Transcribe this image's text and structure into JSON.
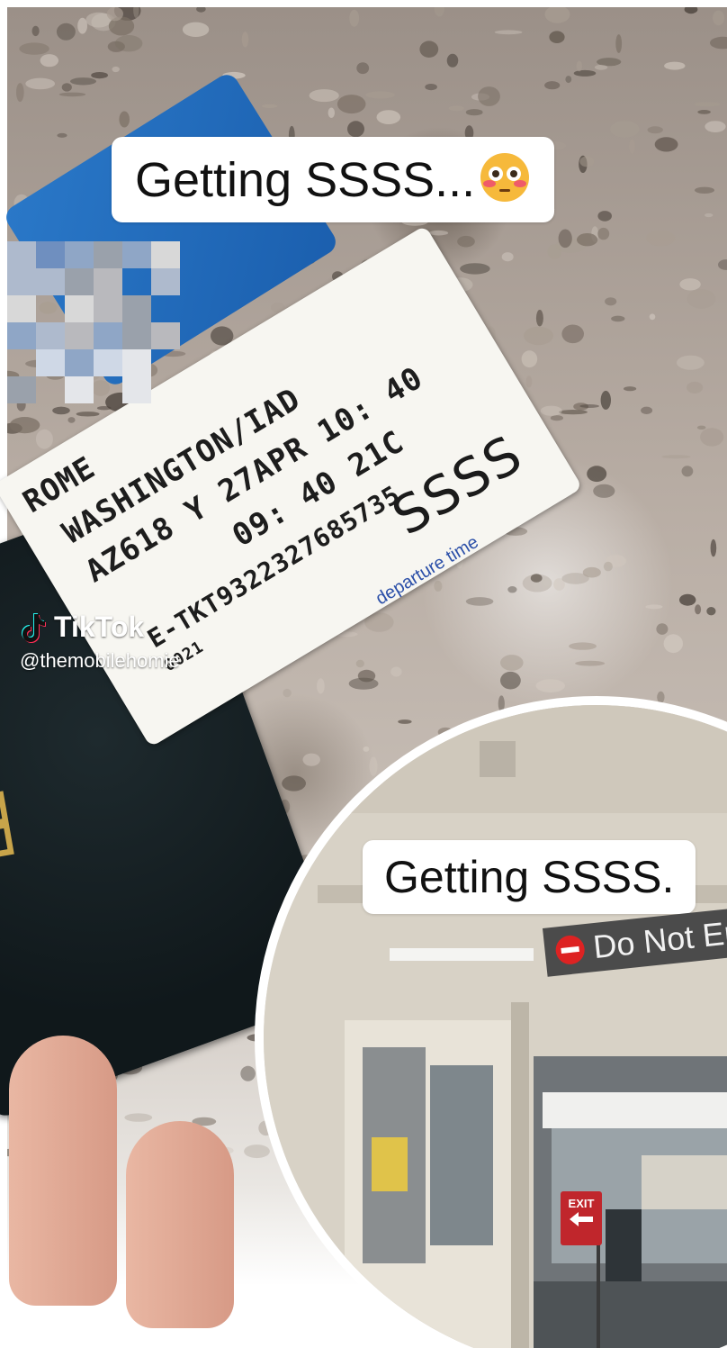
{
  "captions": {
    "top": "Getting SSSS...",
    "inset": "Getting SSSS."
  },
  "boarding_pass": {
    "line1": "ROME",
    "line2": "WASHINGTON/IAD",
    "line3": "AZ618   Y 27APR  10: 40",
    "line4": "09: 40  21C",
    "line5": "E-TKT9322327685735",
    "line6": "0021",
    "ssss": "SSSS",
    "note": "departure time"
  },
  "watermark": {
    "brand": "TikTok",
    "handle": "@themobilehomie"
  },
  "passport": {
    "visible_text": "RT"
  },
  "signs": {
    "do_not_enter": "Do Not Ent",
    "exit": "EXIT"
  },
  "colors": {
    "card_blue": "#1f66b8",
    "passport": "#14202a",
    "passport_gold": "#c8a44a",
    "exit_red": "#c0262c"
  },
  "icons": {
    "emoji": "flushed-face-icon",
    "tiktok": "tiktok-logo-icon",
    "no_entry": "no-entry-icon"
  }
}
